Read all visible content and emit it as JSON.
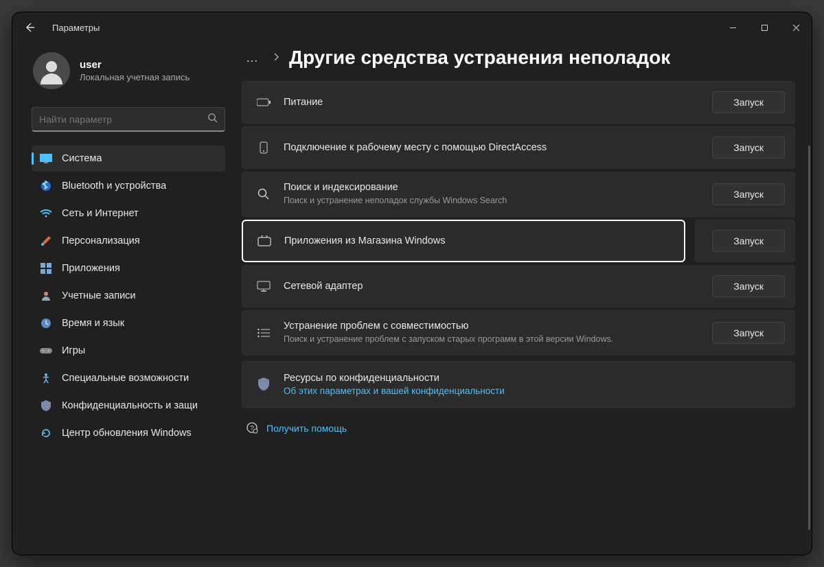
{
  "window": {
    "title": "Параметры"
  },
  "profile": {
    "username": "user",
    "subtitle": "Локальная учетная запись"
  },
  "search": {
    "placeholder": "Найти параметр"
  },
  "sidebar": {
    "items": [
      {
        "id": "system",
        "label": "Система",
        "active": true
      },
      {
        "id": "bluetooth",
        "label": "Bluetooth и устройства"
      },
      {
        "id": "network",
        "label": "Сеть и Интернет"
      },
      {
        "id": "personalization",
        "label": "Персонализация"
      },
      {
        "id": "apps",
        "label": "Приложения"
      },
      {
        "id": "accounts",
        "label": "Учетные записи"
      },
      {
        "id": "time",
        "label": "Время и язык"
      },
      {
        "id": "gaming",
        "label": "Игры"
      },
      {
        "id": "accessibility",
        "label": "Специальные возможности"
      },
      {
        "id": "privacy",
        "label": "Конфиденциальность и защи"
      },
      {
        "id": "update",
        "label": "Центр обновления Windows"
      }
    ]
  },
  "header": {
    "breadcrumb_ellipsis": "…",
    "title": "Другие средства устранения неполадок"
  },
  "run_label": "Запуск",
  "troubleshooters": [
    {
      "id": "power",
      "title": "Питание",
      "sub": ""
    },
    {
      "id": "directaccess",
      "title": "Подключение к рабочему месту с помощью DirectAccess",
      "sub": ""
    },
    {
      "id": "search",
      "title": "Поиск и индексирование",
      "sub": "Поиск и устранение неполадок службы Windows Search"
    },
    {
      "id": "store",
      "title": "Приложения из Магазина Windows",
      "sub": "",
      "highlight": true
    },
    {
      "id": "netadapter",
      "title": "Сетевой адаптер",
      "sub": ""
    },
    {
      "id": "compat",
      "title": "Устранение проблем с совместимостью",
      "sub": "Поиск и устранение проблем с запуском старых программ в этой версии Windows."
    }
  ],
  "privacy_block": {
    "title": "Ресурсы по конфиденциальности",
    "link": "Об этих параметрах и вашей конфиденциальности"
  },
  "help": {
    "label": "Получить помощь"
  }
}
